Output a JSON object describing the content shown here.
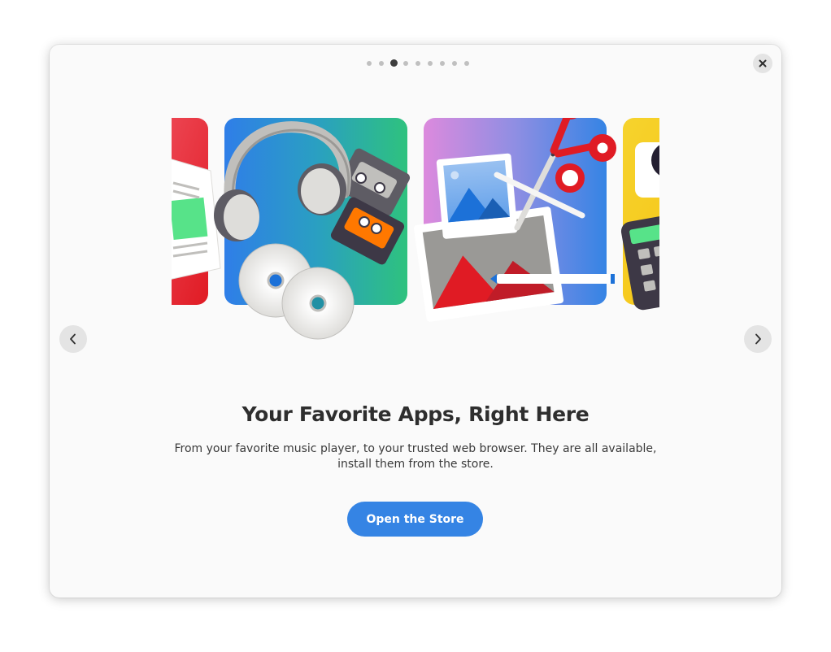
{
  "pager": {
    "total_pages": 9,
    "current_page": 3
  },
  "controls": {
    "close_icon": "close-icon",
    "prev_icon": "chevron-left-icon",
    "next_icon": "chevron-right-icon"
  },
  "illustration": {
    "cards": [
      {
        "icon": "newspaper-icon",
        "colors": [
          "#f0505e",
          "#e01b24"
        ]
      },
      {
        "icon": "music-icon",
        "colors": [
          "#2f7ee8",
          "#2ec27e"
        ]
      },
      {
        "icon": "photos-icon",
        "colors": [
          "#dc8add",
          "#3584e4"
        ]
      },
      {
        "icon": "calculator-icon",
        "colors": [
          "#f6d32d",
          "#f5c211"
        ]
      }
    ]
  },
  "page": {
    "title": "Your Favorite Apps, Right Here",
    "description": "From your favorite music player, to your trusted web browser. They are all available, install them from the store.",
    "button_label": "Open the Store"
  },
  "colors": {
    "accent": "#3584e4",
    "window_bg": "#fafafa",
    "text": "#2e2e2e"
  }
}
